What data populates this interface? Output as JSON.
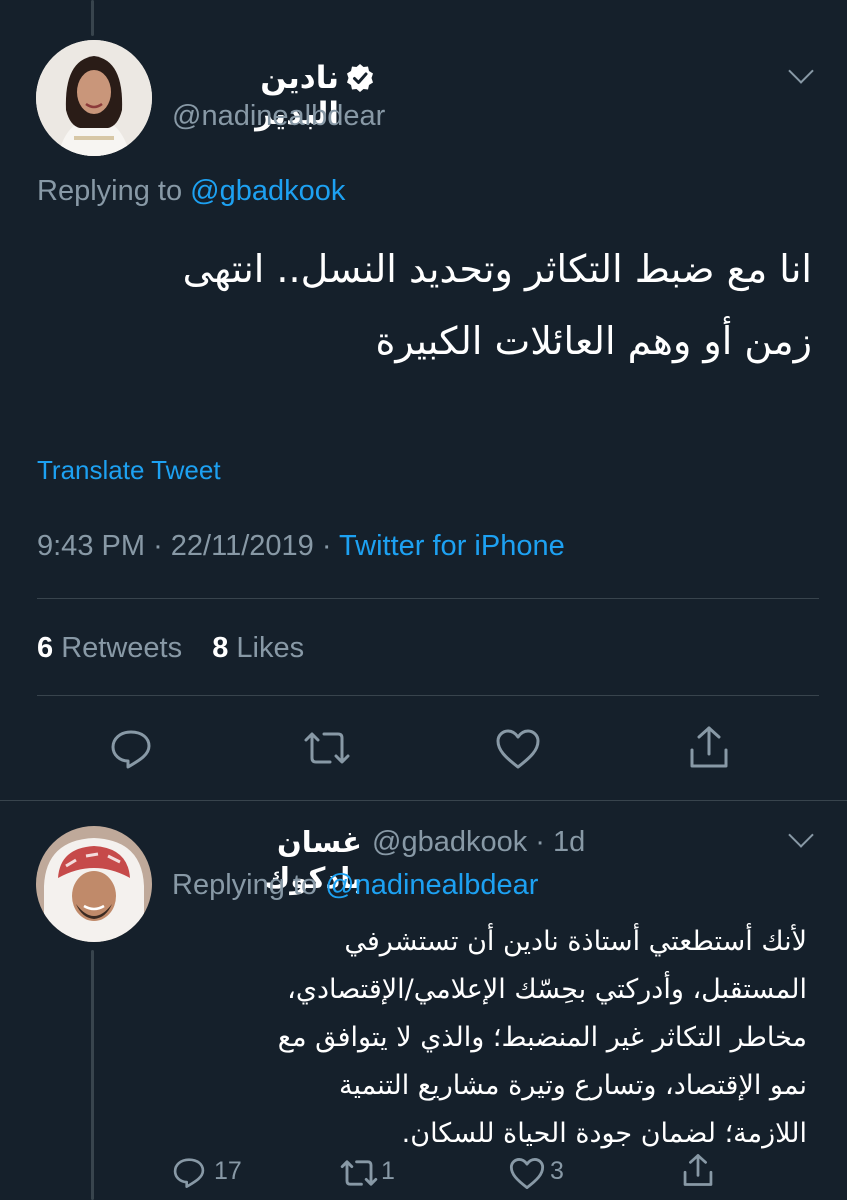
{
  "main_tweet": {
    "display_name": "نادين البدير",
    "handle": "@nadinealbdear",
    "replying_prefix": "Replying to",
    "replying_to": "@gbadkook",
    "text_line1": "انا مع ضبط التكاثر وتحديد النسل.. انتهى",
    "text_line2": "زمن أو وهم العائلات الكبيرة",
    "translate_label": "Translate Tweet",
    "time": "9:43 PM",
    "date": "22/11/2019",
    "source": "Twitter for iPhone",
    "retweets_count": "6",
    "retweets_label": "Retweets",
    "likes_count": "8",
    "likes_label": "Likes"
  },
  "reply_tweet": {
    "display_name": "غسان بادكوك",
    "handle": "@gbadkook",
    "age": "1d",
    "replying_prefix": "Replying to",
    "replying_to": "@nadinealbdear",
    "lines": [
      "لأنك أستطعتي أستاذة نادين أن تستشرفي",
      "المستقبل، وأدركتي بحِسّك الإعلامي/الإقتصادي،",
      "مخاطر التكاثر غير المنضبط؛ والذي لا يتوافق مع",
      "نمو الإقتصاد، وتسارع وتيرة مشاريع التنمية",
      "اللازمة؛ لضمان جودة الحياة للسكان."
    ],
    "reply_count": "17",
    "retweet_count": "1",
    "like_count": "3"
  },
  "colors": {
    "background": "#15202b",
    "accent": "#1da1f2",
    "muted": "#8899a6",
    "divider": "#38444d"
  }
}
